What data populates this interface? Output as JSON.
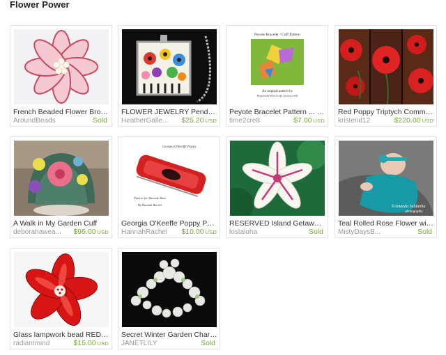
{
  "page": {
    "title": "Flower Power"
  },
  "items": [
    {
      "title": "French Beaded Flower Brooc...",
      "shop": "AroundBeads",
      "price": "Sold",
      "currency": ""
    },
    {
      "title": "FLOWER JEWELRY Pendan...",
      "shop": "HeatherGalle...",
      "price": "$25.20",
      "currency": "USD"
    },
    {
      "title": "Peyote Bracelet Pattern ... W...",
      "shop": "time2cre8",
      "price": "$7.00",
      "currency": "USD",
      "thumb_text": {
        "line1": "Peyote Bracelet / Cuff Pattern",
        "line2": "An original pattern by",
        "line3": "Marybeth Wolowski (time2cre8)"
      }
    },
    {
      "title": "Red Poppy Triptych Commis...",
      "shop": "kristend12",
      "price": "$220.00",
      "currency": "USD"
    },
    {
      "title": "A Walk in My Garden Cuff",
      "shop": "deborahawea...",
      "price": "$95.00",
      "currency": "USD"
    },
    {
      "title": "Georgia O'Keeffe Poppy Patt...",
      "shop": "HannahRachel",
      "price": "$10.00",
      "currency": "USD",
      "thumb_text": {
        "line1": "Georgia O'Keeffe Poppy",
        "line2": "Pattern for Barrette Base",
        "line3": "By Hannah Rachel"
      }
    },
    {
      "title": "RESERVED Island Getaway ...",
      "shop": "lostaloha",
      "price": "Sold",
      "currency": ""
    },
    {
      "title": "Teal Rolled Rose Flower with ...",
      "shop": "MistyDaysB...",
      "price": "Sold",
      "currency": "",
      "thumb_text": {
        "line1": "©Amanda Saldanha",
        "line2": "photography"
      }
    },
    {
      "title": "Glass lampwork bead RED HI...",
      "shop": "radiantmind",
      "price": "$15.00",
      "currency": "USD"
    },
    {
      "title": "Secret Winter Garden Charm ...",
      "shop": "JANETLILY",
      "price": "Sold",
      "currency": ""
    }
  ],
  "colors": {
    "sold": "#7aa83a",
    "price": "#7aa83a",
    "shop": "#9a9a9a"
  }
}
